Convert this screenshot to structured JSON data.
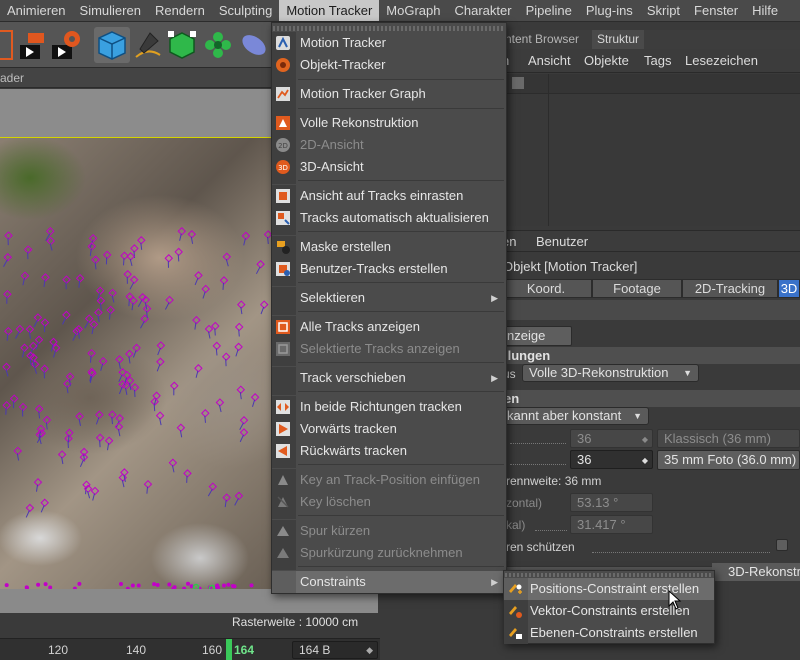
{
  "menubar": {
    "items": [
      "Animieren",
      "Simulieren",
      "Rendern",
      "Sculpting",
      "Motion Tracker",
      "MoGraph",
      "Charakter",
      "Pipeline",
      "Plug-ins",
      "Skript",
      "Fenster",
      "Hilfe"
    ],
    "active": "Motion Tracker"
  },
  "viewport": {
    "header": "ader",
    "raster_label": "Rasterweite : 10000 cm",
    "accent": "#d4d400",
    "track_color": "#c200c8"
  },
  "timeline": {
    "ticks": [
      "120",
      "140",
      "160",
      "164"
    ],
    "current_frame": "164",
    "frame_field": "164 B",
    "playhead_color": "#3ac95a"
  },
  "right_panel": {
    "tabs": [
      "ntent Browser",
      "Struktur"
    ],
    "menu": [
      "n",
      "Ansicht",
      "Objekte",
      "Tags",
      "Lesezeichen"
    ],
    "attr_menu": [
      "en",
      "Benutzer"
    ],
    "object_title": "Objekt [Motion Tracker]",
    "attr_tabs": [
      "Koord.",
      "Footage",
      "2D-Tracking",
      "3D"
    ],
    "active_tab": "3D",
    "display_button": "nzeige",
    "sect1": "llungen",
    "mode_label": "us",
    "mode_value": "Volle 3D-Rekonstruktion",
    "sect2": "en",
    "focal_drop": "kannt aber konstant",
    "sensor_value_dim": "36",
    "sensor_value": "36",
    "preset_dim": "Klassisch (36 mm)",
    "preset": "35 mm Foto (36.0 mm)",
    "focal_label": "rennweite: 36 mm",
    "fov_h_label": "zontal)",
    "fov_h_value": "53.13 °",
    "fov_v_label": "kal)",
    "fov_v_value": "31.417 °",
    "protect_label": "ren schützen",
    "rekon_button": "3D-Rekonstr"
  },
  "menu": {
    "items": [
      {
        "label": "Motion Tracker",
        "icon": "motion-tracker-icon",
        "disabled": false
      },
      {
        "label": "Objekt-Tracker",
        "icon": "object-tracker-icon",
        "disabled": false
      },
      {
        "label": "Motion Tracker Graph",
        "icon": "graph-icon",
        "disabled": false
      },
      {
        "label": "Volle Rekonstruktion",
        "icon": "reconstruction-icon",
        "disabled": false
      },
      {
        "label": "2D-Ansicht",
        "icon": "2d-view-icon",
        "disabled": true
      },
      {
        "label": "3D-Ansicht",
        "icon": "3d-view-icon",
        "disabled": false
      },
      {
        "label": "Ansicht auf Tracks einrasten",
        "icon": "snap-view-icon",
        "disabled": false
      },
      {
        "label": "Tracks automatisch aktualisieren",
        "icon": "auto-update-icon",
        "disabled": false
      },
      {
        "label": "Maske erstellen",
        "icon": "mask-icon",
        "disabled": false
      },
      {
        "label": "Benutzer-Tracks erstellen",
        "icon": "user-tracks-icon",
        "disabled": false
      },
      {
        "label": "Selektieren",
        "icon": "",
        "disabled": false,
        "submenu": true
      },
      {
        "label": "Alle Tracks anzeigen",
        "icon": "show-all-tracks-icon",
        "disabled": false
      },
      {
        "label": "Selektierte Tracks anzeigen",
        "icon": "show-selected-tracks-icon",
        "disabled": true
      },
      {
        "label": "Track verschieben",
        "icon": "",
        "disabled": false,
        "submenu": true
      },
      {
        "label": "In beide Richtungen tracken",
        "icon": "track-both-icon",
        "disabled": false
      },
      {
        "label": "Vorwärts tracken",
        "icon": "track-forward-icon",
        "disabled": false
      },
      {
        "label": "Rückwärts tracken",
        "icon": "track-backward-icon",
        "disabled": false
      },
      {
        "label": "Key an Track-Position einfügen",
        "icon": "insert-key-icon",
        "disabled": true
      },
      {
        "label": "Key löschen",
        "icon": "delete-key-icon",
        "disabled": true
      },
      {
        "label": "Spur kürzen",
        "icon": "trim-track-icon",
        "disabled": true
      },
      {
        "label": "Spurkürzung zurücknehmen",
        "icon": "undo-trim-icon",
        "disabled": true
      },
      {
        "label": "Constraints",
        "icon": "",
        "disabled": false,
        "submenu": true,
        "highlighted": true
      }
    ]
  },
  "submenu": {
    "items": [
      {
        "label": "Positions-Constraint erstellen",
        "icon": "position-constraint-icon",
        "highlighted": true
      },
      {
        "label": "Vektor-Constraints erstellen",
        "icon": "vector-constraint-icon"
      },
      {
        "label": "Ebenen-Constraints erstellen",
        "icon": "plane-constraint-icon"
      }
    ]
  }
}
